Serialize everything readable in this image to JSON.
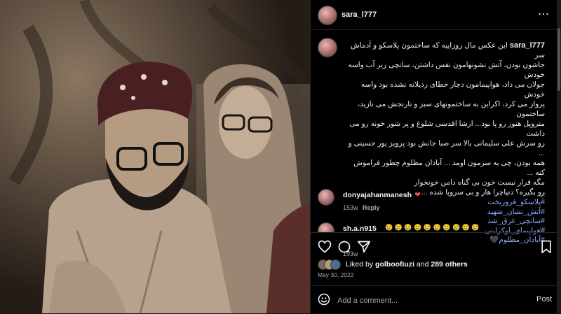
{
  "post": {
    "username": "sara_l777",
    "caption_username": "sara_l777",
    "caption_text": "این عکس مال روزاییه که ساختمون پلاسکو و آدماش سر\nجاشون بودن، آتش نشونهامون نفس داشتن، سانچی زیر آب واسه خودش\nجولان می داد، هواپیمامون دچار خطای رذیلانه نشده بود واسه خودش\nپرواز می کرد، اکراین به ساختمونهای سبز و نارنجش می نازید، ساختمون\nمتروپل هنوز رو پا بود... ارشا اقدسی شلوغ و پر شور خونه رو می داشت\nرو سرش علی سلیمانی بالا سر صبا جانش بود پرویز پور حسینی و ...\nهمه بودن، چی به سرمون اومد ... آبادان مظلوم چطور فراموش کنه ...\nمگه قرار نیست خون بی گناه دامن خونخوار\nرو بگیره؟ دنیاچرا هار و بی سروپا شده ...",
    "hashtags": [
      "#پلاسکو_فروریخت",
      "#آتش_نشان_شهید",
      "#سانچی_غرق_شد",
      "#هواپیمای_اوکراینی",
      "#آبادان_مظلوم🖤"
    ],
    "caption_age": "193w",
    "comments": [
      {
        "username": "donyajahanmanesh",
        "text": "❤",
        "age": "153w",
        "reply_label": "Reply"
      },
      {
        "username": "sh.a.n915",
        "text": "😢 😢 😢 😢 😢 😢 😢 😢 😢 😢"
      }
    ],
    "likes_prefix": "Liked by ",
    "liked_by": "golboofiuzi",
    "likes_and": " and ",
    "likes_others": "289 others",
    "date": "May 30, 2022",
    "comment_placeholder": "Add a comment...",
    "post_label": "Post"
  },
  "colors": {
    "hashtag": "#8fa8ff",
    "heart": "#ed4956"
  },
  "icons": [
    "more-icon",
    "heart-icon",
    "comment-icon",
    "share-icon",
    "bookmark-icon",
    "emoji-icon"
  ]
}
